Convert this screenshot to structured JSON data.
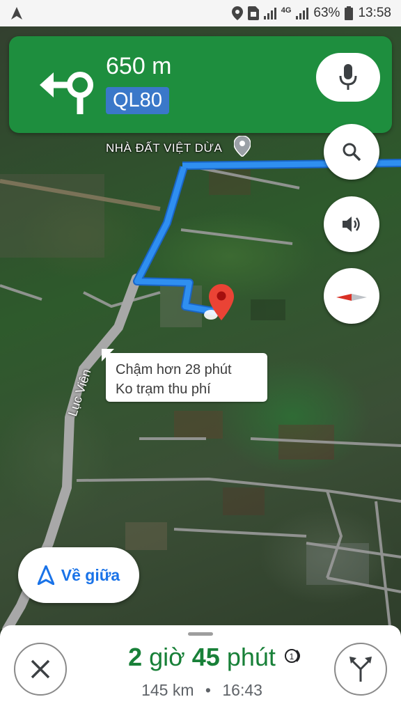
{
  "status_bar": {
    "battery_percent": "63%",
    "time": "13:58",
    "network": "4G",
    "icons": [
      "navigation-arrow-icon",
      "location-icon",
      "sim-icon",
      "signal-icon",
      "battery-icon"
    ]
  },
  "nav": {
    "distance": "650 m",
    "road": "QL80",
    "maneuver_icon": "turn-left-roundabout-icon",
    "accent_color": "#1e8e3e",
    "road_badge_color": "#3a78c9"
  },
  "map": {
    "poi_label": "NHÀ ĐẤT VIỆT DỪA",
    "road_label": "Lục Viên",
    "callout_line1": "Chậm hơn 28 phút",
    "callout_line2": "Ko trạm thu phí",
    "route_color": "#2f8ff0",
    "buttons": [
      "search-icon",
      "volume-icon",
      "compass-icon"
    ]
  },
  "recenter": {
    "label": "Về giữa"
  },
  "trip": {
    "hours": "2",
    "hours_unit": "giờ",
    "minutes": "45",
    "minutes_unit": "phút",
    "distance": "145 km",
    "separator": "•",
    "arrival": "16:43",
    "eta_color": "#188038"
  }
}
